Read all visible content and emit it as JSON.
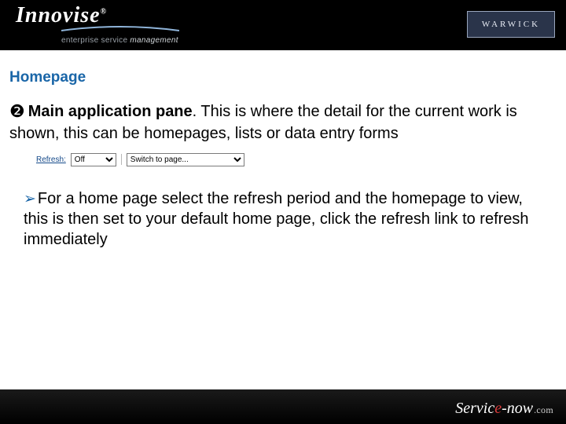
{
  "header": {
    "logo_text": "Innovise",
    "logo_reg": "®",
    "logo_sub_prefix": "enterprise service ",
    "logo_sub_em": "management",
    "warwick": "WARWICK"
  },
  "title": "Homepage",
  "main": {
    "bullet_glyph": "❷",
    "lead": "Main application pane",
    "lead_suffix": ".",
    "rest": " This is where the detail for the current work is shown, this can be homepages, lists or data entry forms"
  },
  "toolbar": {
    "refresh_label": "Refresh:",
    "period_selected": "Off",
    "page_selected": "Switch to page..."
  },
  "sub": {
    "arrow_glyph": "➢",
    "text": "For a home page select the refresh period and the homepage to view, this is then set to your default home page, click the refresh link to refresh immediately"
  },
  "footer": {
    "brand_left_head": "Servic",
    "brand_left_highlight": "e",
    "brand_left_tail": "-now",
    "brand_right": ".com"
  }
}
